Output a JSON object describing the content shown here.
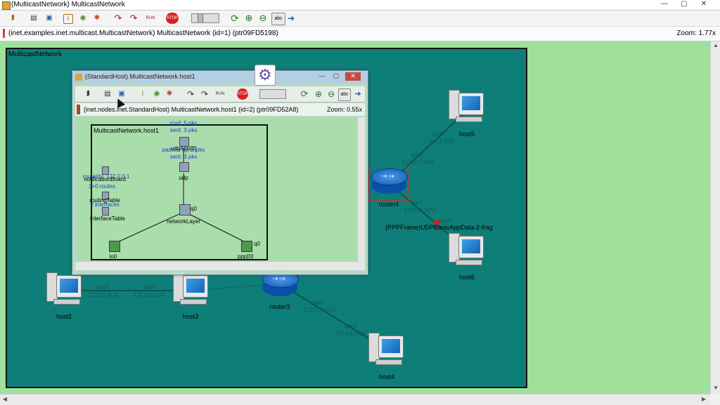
{
  "window": {
    "title": "(MulticastNetwork) MulticastNetwork",
    "buttons": {
      "minimize": "—",
      "maximize": "▢",
      "close": "✕"
    }
  },
  "toolbar": {
    "items": [
      {
        "icon": "up-arrow-icon",
        "glyph": "⮭"
      },
      {
        "icon": "module-list-icon",
        "glyph": "▤"
      },
      {
        "icon": "graphics-icon",
        "glyph": "▣"
      },
      {
        "icon": "info-icon",
        "glyph": "i"
      },
      {
        "icon": "find-icon",
        "glyph": "◉"
      },
      {
        "icon": "object-tree-icon",
        "glyph": "✱"
      },
      {
        "icon": "step-icon",
        "glyph": "↷"
      },
      {
        "icon": "run-icon",
        "glyph": "↷"
      },
      {
        "icon": "fast-run-icon",
        "glyph": "RUN"
      },
      {
        "icon": "stop-icon",
        "glyph": "STOP"
      },
      {
        "icon": "speed-slider-icon",
        "glyph": ""
      },
      {
        "icon": "refresh-icon",
        "glyph": "⟳"
      },
      {
        "icon": "zoom-in-icon",
        "glyph": "⊕"
      },
      {
        "icon": "zoom-out-icon",
        "glyph": "⊖"
      },
      {
        "icon": "labels-icon",
        "glyph": "abc"
      },
      {
        "icon": "animate-icon",
        "glyph": "➔"
      }
    ]
  },
  "pathbar": {
    "path": "(inet.examples.inet.multicast.MulticastNetwork) MulticastNetwork  (id=1)  (ptr09FD5198)",
    "zoom": "Zoom: 1.77x"
  },
  "network": {
    "label": "MulticastNetwork",
    "nodes": {
      "host2": "host2",
      "host3": "host3",
      "host4": "host4",
      "host5": "host5",
      "host6": "host6",
      "router3": "router3",
      "router4": "router4"
    },
    "links": {
      "host2_ppp": "ppp0",
      "host2_ip": "172.0.0.4/24",
      "host3_ppp": "ppp0",
      "host3_ip": "172.0.0.5/24",
      "router3_ppp": "ppp0",
      "router3_ip": "172.0.1.2/24",
      "host4_ppp": "ppp0",
      "host4_ip": "172.0.1.3/24",
      "host5_ppp": "ppp0",
      "host5_ip": "172.0.2.1/24",
      "router4_ppp_up": "ppp0",
      "router4_ip_up": "172.0.2.3/24",
      "router4_ppp_down": "ppp1",
      "router4_ip_down": "172.0.3.3/24",
      "host6_ppp": "ppp0"
    },
    "message": "(PPPFrame)UDPBasicAppData-2-frag"
  },
  "inner_window": {
    "title": "(StandardHost) MulticastNetwork.host1",
    "path": "(inet.nodes.inet.StandardHost) MulticastNetwork.host1  (id=2)  (ptr09FD52A8)",
    "zoom": "Zoom: 0.55x",
    "box_label": "MulticastNetwork.host1",
    "modules": {
      "udpApp": "udpApp[0]",
      "udpApp_rcvd": "rcvd: 5 pks",
      "udpApp_sent": "sent: 3 pks",
      "udp_passed": "passed up: 6 pks",
      "udp_sent": "sent: 3 pks",
      "udp": "udp",
      "routing": "routeIds: 172.0.0.1",
      "notification": "notificationBoard",
      "routes": "3+0 routes",
      "routingTable": "routingTable",
      "interfaces": "2 interfaces",
      "interfaceTable": "interfaceTable",
      "networkLayer": "networkLayer",
      "lo0": "lo0",
      "ppp0": "ppp[0]",
      "gate_ifOut": "q0",
      "gate_ppp": "q0"
    }
  }
}
